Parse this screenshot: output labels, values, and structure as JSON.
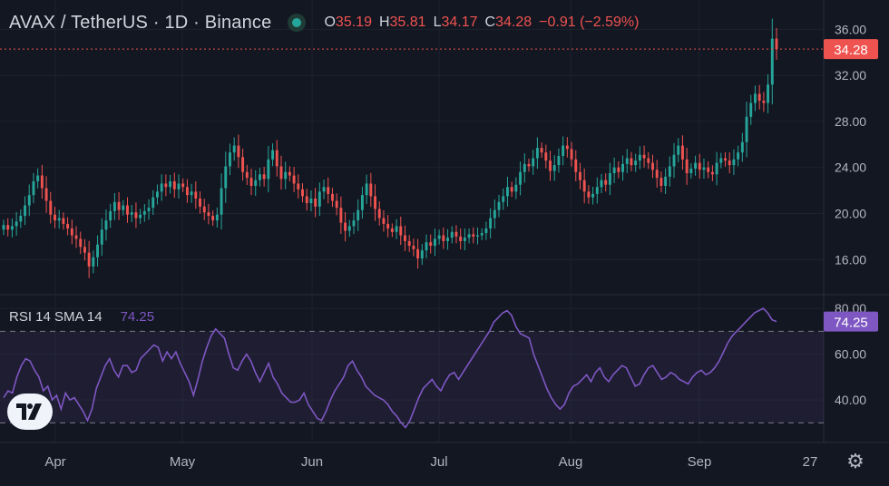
{
  "legend": {
    "symbol": "AVAX / TetherUS · 1D · Binance",
    "o_label": "O",
    "o": "35.19",
    "h_label": "H",
    "h": "35.81",
    "l_label": "L",
    "l": "34.17",
    "c_label": "C",
    "c": "34.28",
    "change": "−0.91 (−2.59%)"
  },
  "rsi_legend": {
    "name": "RSI 14 SMA 14",
    "value": "74.25"
  },
  "colors": {
    "up": "#26a69a",
    "down": "#ef5350",
    "rsi": "#7e57c2",
    "background": "#131722"
  },
  "icons": {
    "logo": "tradingview-logo",
    "settings": "gear-icon"
  },
  "chart_data": [
    {
      "type": "candlestick",
      "x_axis_ticks": [
        "Apr",
        "May",
        "Jun",
        "Jul",
        "Aug",
        "Sep",
        "27"
      ],
      "y_ticks": [
        "36.00",
        "32.00",
        "28.00",
        "24.00",
        "20.00",
        "16.00"
      ],
      "ylim": [
        13.5,
        37.6
      ],
      "last_price_label": "34.28",
      "grid": true,
      "close_series": [
        19.0,
        18.6,
        18.9,
        19.3,
        19.8,
        20.7,
        21.6,
        22.8,
        23.3,
        22.2,
        21.1,
        19.9,
        19.4,
        19.6,
        19.1,
        18.7,
        18.1,
        17.8,
        17.1,
        16.6,
        15.4,
        16.2,
        17.3,
        18.6,
        19.4,
        20.2,
        21.0,
        20.3,
        20.7,
        19.9,
        20.1,
        19.6,
        19.9,
        20.2,
        20.5,
        21.4,
        21.9,
        22.6,
        22.3,
        22.8,
        22.1,
        22.6,
        22.3,
        21.6,
        21.9,
        21.3,
        20.6,
        20.1,
        19.8,
        19.4,
        19.9,
        22.2,
        24.1,
        25.3,
        25.9,
        24.9,
        23.6,
        23.1,
        22.4,
        22.9,
        23.4,
        23.0,
        24.7,
        25.5,
        24.1,
        23.0,
        23.6,
        23.3,
        22.6,
        22.1,
        21.5,
        20.9,
        21.3,
        20.6,
        21.9,
        22.3,
        21.7,
        21.1,
        20.5,
        19.2,
        18.5,
        18.9,
        19.4,
        20.3,
        21.6,
        22.6,
        21.5,
        20.4,
        19.6,
        19.1,
        18.7,
        18.4,
        18.9,
        18.1,
        17.6,
        17.2,
        16.9,
        16.1,
        16.8,
        17.5,
        17.2,
        17.8,
        18.1,
        17.6,
        17.9,
        18.4,
        18.0,
        17.6,
        17.9,
        18.2,
        18.0,
        18.1,
        18.3,
        18.7,
        19.6,
        20.3,
        21.0,
        21.5,
        22.3,
        21.9,
        22.5,
        23.6,
        24.3,
        24.1,
        24.8,
        25.7,
        25.3,
        24.6,
        23.7,
        24.2,
        25.0,
        25.9,
        25.6,
        24.7,
        23.6,
        22.9,
        21.9,
        21.4,
        21.7,
        22.3,
        22.9,
        22.5,
        23.5,
        24.0,
        23.6,
        24.3,
        24.8,
        24.2,
        24.6,
        25.1,
        24.8,
        24.4,
        23.8,
        23.1,
        22.4,
        23.2,
        24.1,
        25.1,
        25.9,
        24.7,
        23.5,
        23.9,
        24.4,
        23.8,
        24.0,
        23.6,
        23.4,
        24.4,
        24.8,
        24.6,
        24.2,
        24.7,
        25.3,
        26.2,
        28.4,
        29.6,
        30.4,
        29.8,
        29.6,
        31.2,
        35.19,
        34.28
      ]
    },
    {
      "type": "line",
      "name": "RSI 14 SMA 14",
      "y_ticks": [
        "80.00",
        "60.00",
        "40.00"
      ],
      "ylim": [
        23,
        84
      ],
      "bands": [
        70,
        30
      ],
      "last_value_label": "74.25",
      "values": [
        41,
        44,
        43,
        50,
        55,
        58,
        57,
        53,
        50,
        44,
        46,
        40,
        42,
        36,
        43,
        40,
        41,
        38,
        35,
        31,
        36,
        45,
        50,
        55,
        58,
        53,
        50,
        55,
        55,
        52,
        53,
        58,
        60,
        62,
        64,
        63,
        57,
        61,
        58,
        61,
        56,
        52,
        48,
        42,
        49,
        57,
        63,
        68,
        71,
        69,
        67,
        60,
        54,
        53,
        57,
        60,
        57,
        52,
        48,
        52,
        56,
        50,
        47,
        43,
        41,
        39,
        39,
        40,
        43,
        38,
        35,
        32,
        31,
        35,
        40,
        44,
        47,
        50,
        55,
        57,
        53,
        50,
        46,
        44,
        42,
        41,
        40,
        38,
        35,
        33,
        30,
        28,
        31,
        36,
        41,
        45,
        47,
        49,
        46,
        44,
        48,
        51,
        52,
        49,
        52,
        55,
        58,
        61,
        64,
        67,
        70,
        74,
        76,
        78,
        79,
        77,
        72,
        69,
        68,
        67,
        60,
        55,
        50,
        45,
        41,
        38,
        36,
        38,
        43,
        46,
        47,
        49,
        51,
        48,
        52,
        54,
        50,
        48,
        51,
        53,
        55,
        54,
        50,
        46,
        47,
        51,
        54,
        55,
        52,
        49,
        50,
        52,
        51,
        49,
        48,
        47,
        50,
        52,
        53,
        51,
        52,
        54,
        57,
        61,
        65,
        68,
        70,
        72,
        74,
        76,
        78,
        79,
        80,
        78,
        75,
        74.25
      ]
    }
  ]
}
